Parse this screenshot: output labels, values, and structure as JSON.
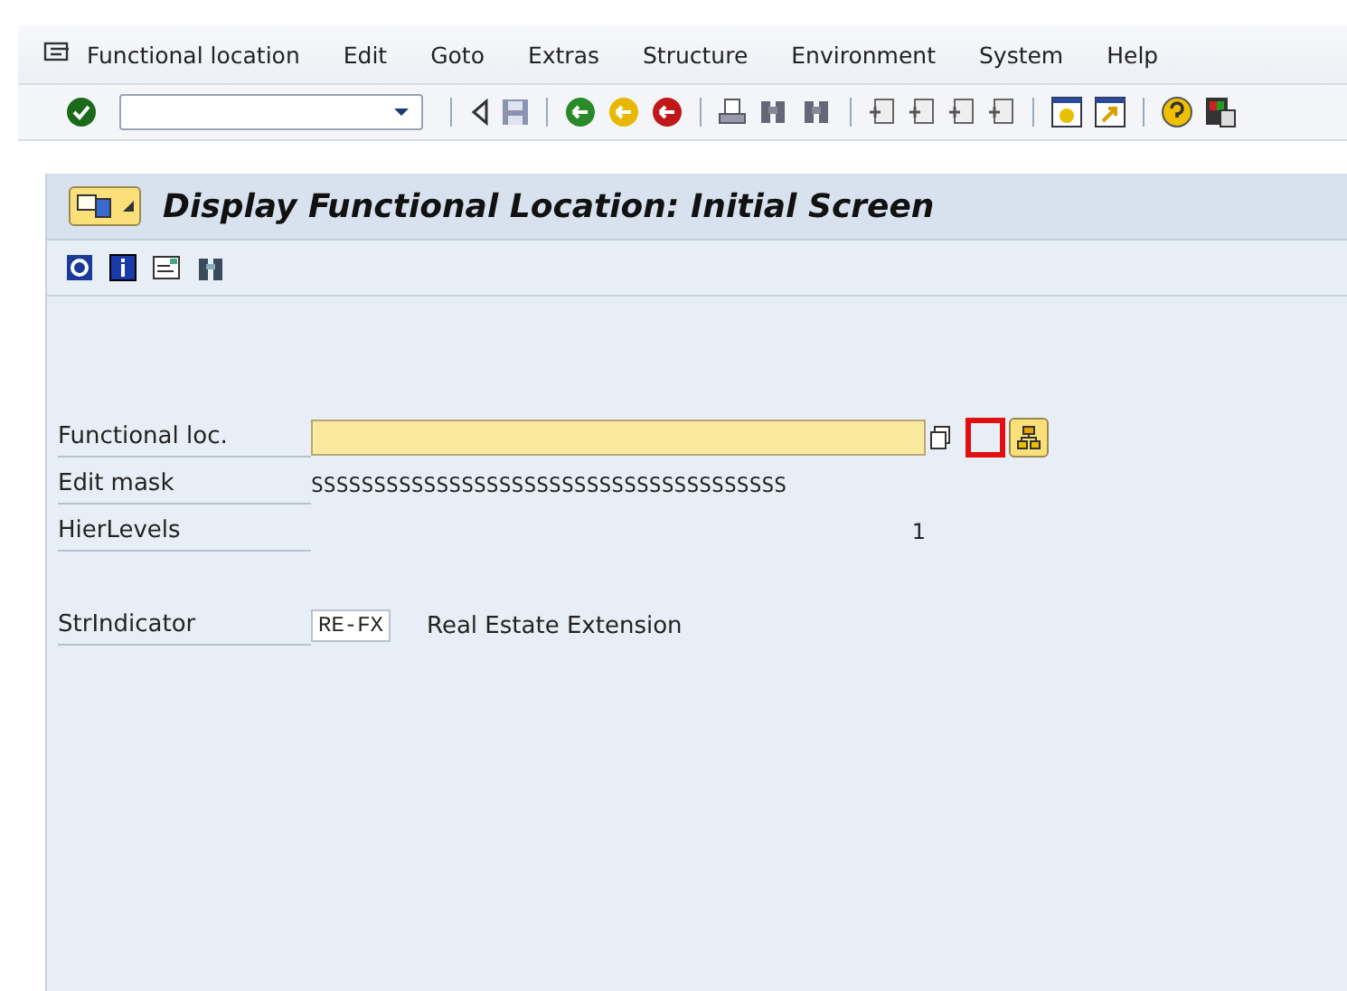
{
  "menu_bar": {
    "items": [
      "Functional location",
      "Edit",
      "Goto",
      "Extras",
      "Structure",
      "Environment",
      "System",
      "Help"
    ]
  },
  "title": "Display Functional Location: Initial Screen",
  "form": {
    "fields": [
      {
        "kind": "input",
        "label": "Functional loc."
      },
      {
        "kind": "display",
        "label": "Edit mask",
        "value": "SSSSSSSSSSSSSSSSSSSSSSSSSSSSSSSSSSSSSS"
      },
      {
        "kind": "number",
        "label": "HierLevels",
        "value": "1"
      },
      {
        "kind": "indicator",
        "label": "StrIndicator",
        "value": "RE-FX",
        "description": "Real Estate Extension"
      }
    ]
  }
}
